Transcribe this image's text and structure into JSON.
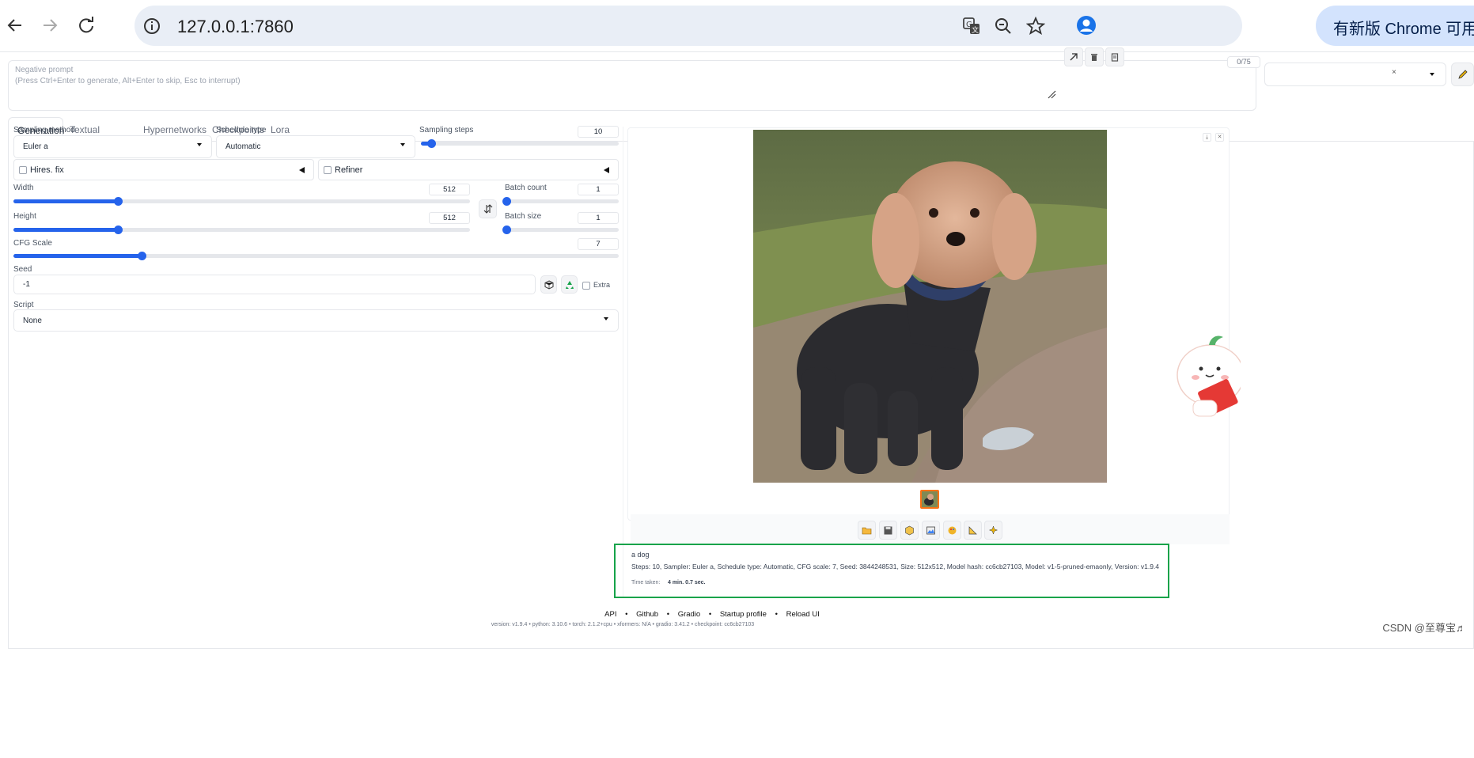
{
  "browser": {
    "url": "127.0.0.1:7860",
    "update_label": "有新版 Chrome 可用"
  },
  "prompt": {
    "negative_label": "Negative prompt",
    "negative_hint": "(Press Ctrl+Enter to generate, Alt+Enter to skip, Esc to interrupt)",
    "token_count": "0/75",
    "style_clear": "×"
  },
  "tabs": [
    "Generation",
    "Textual Inversion",
    "Hypernetworks",
    "Checkpoints",
    "Lora"
  ],
  "generation": {
    "sampling_method_label": "Sampling method",
    "sampling_method_value": "Euler a",
    "schedule_type_label": "Schedule type",
    "schedule_type_value": "Automatic",
    "sampling_steps_label": "Sampling steps",
    "sampling_steps_value": "10",
    "hires_label": "Hires. fix",
    "refiner_label": "Refiner",
    "width_label": "Width",
    "width_value": "512",
    "height_label": "Height",
    "height_value": "512",
    "batch_count_label": "Batch count",
    "batch_count_value": "1",
    "batch_size_label": "Batch size",
    "batch_size_value": "1",
    "cfg_label": "CFG Scale",
    "cfg_value": "7",
    "seed_label": "Seed",
    "seed_value": "-1",
    "extra_label": "Extra",
    "script_label": "Script",
    "script_value": "None"
  },
  "sliders": {
    "sampling_steps_fraction": 0.053,
    "width_fraction": 0.229,
    "height_fraction": 0.229,
    "batch_count_fraction": 0.0,
    "batch_size_fraction": 0.0,
    "cfg_fraction": 0.212
  },
  "output": {
    "prompt_text": "a dog",
    "params_text": "Steps: 10, Sampler: Euler a, Schedule type: Automatic, CFG scale: 7, Seed: 3844248531, Size: 512x512, Model hash: cc6cb27103, Model: v1-5-pruned-emaonly, Version: v1.9.4",
    "time_label": "Time taken:",
    "time_value": "4 min. 0.7 sec."
  },
  "footer": {
    "links": [
      "API",
      "Github",
      "Gradio",
      "Startup profile",
      "Reload UI"
    ],
    "version_line": "version: v1.9.4  •  python: 3.10.6  •  torch: 2.1.2+cpu  •  xformers: N/A  •  gradio: 3.41.2  •  checkpoint: cc6cb27103"
  },
  "watermark": "CSDN @至尊宝♬",
  "colors": {
    "accent": "#2563eb",
    "highlight_box": "#16a34a",
    "thumbnail_border": "#f97316"
  }
}
